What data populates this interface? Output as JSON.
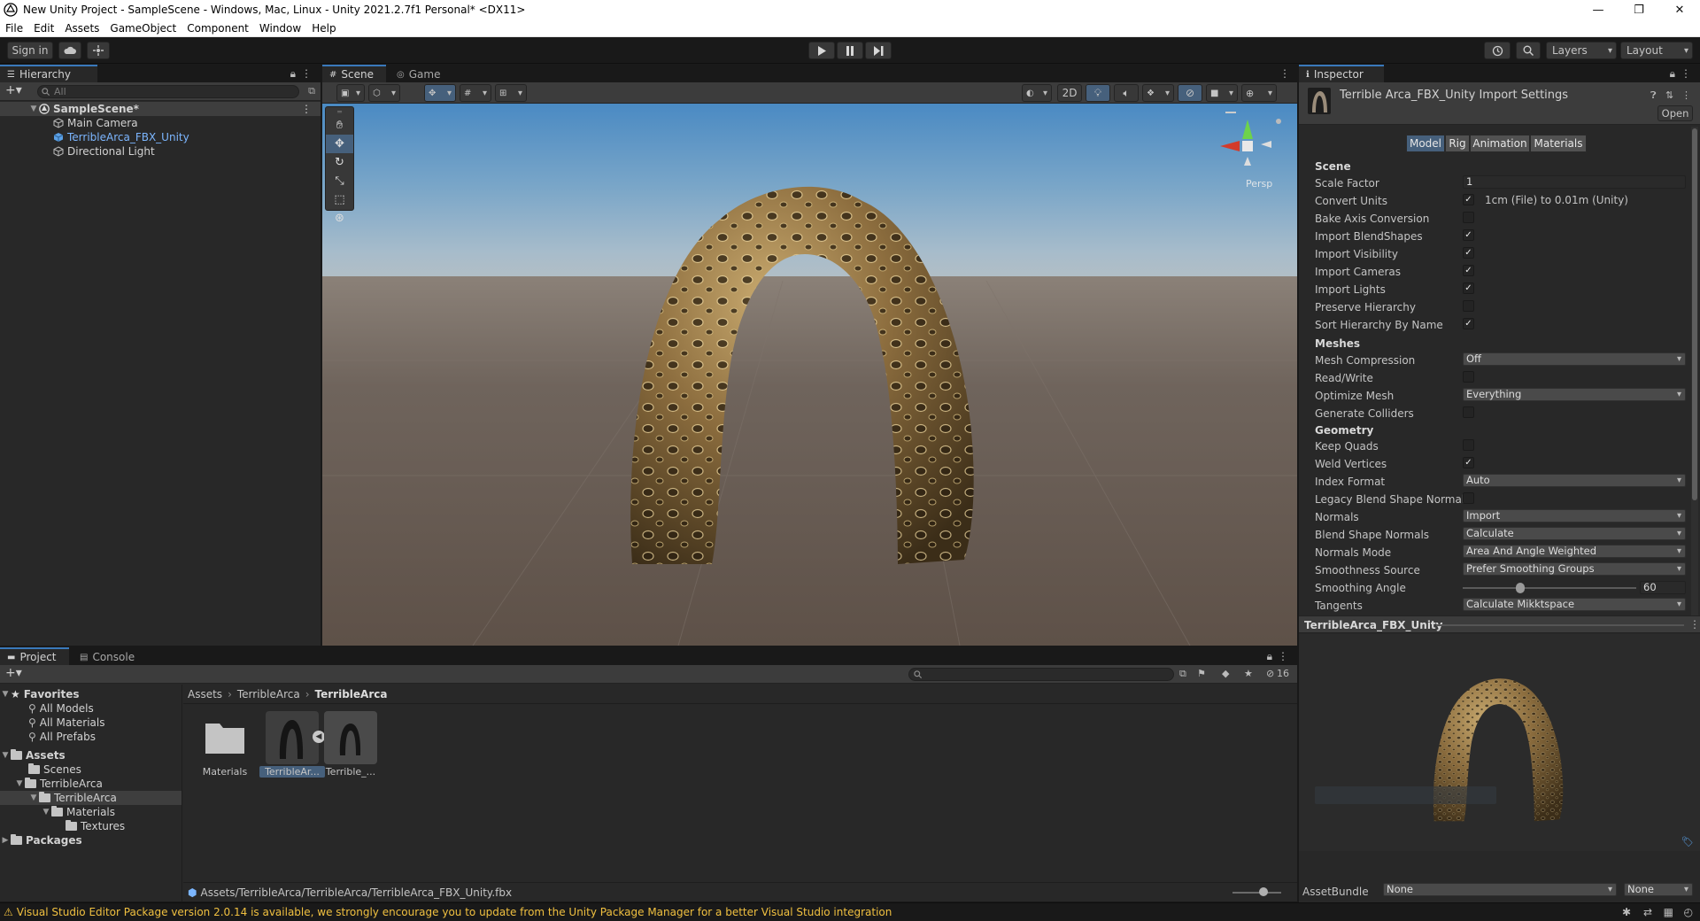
{
  "window": {
    "title": "New Unity Project - SampleScene - Windows, Mac, Linux - Unity 2021.2.7f1 Personal* <DX11>",
    "minimize": "—",
    "restore": "❐",
    "close": "✕"
  },
  "menu": [
    "File",
    "Edit",
    "Assets",
    "GameObject",
    "Component",
    "Window",
    "Help"
  ],
  "toolbar": {
    "sign_in": "Sign in",
    "layers": "Layers",
    "layout": "Layout"
  },
  "hierarchy": {
    "tab": "Hierarchy",
    "search_placeholder": "All",
    "items": [
      {
        "label": "SampleScene*"
      },
      {
        "label": "Main Camera"
      },
      {
        "label": "TerribleArca_FBX_Unity"
      },
      {
        "label": "Directional Light"
      }
    ]
  },
  "scene": {
    "tabs": [
      "Scene",
      "Game"
    ],
    "mode_2d": "2D",
    "persp": "Persp"
  },
  "inspector": {
    "tab": "Inspector",
    "header_title": "Terrible Arca_FBX_Unity Import Settings",
    "open_button": "Open",
    "subtabs": [
      "Model",
      "Rig",
      "Animation",
      "Materials"
    ],
    "section_scene": "Scene",
    "section_meshes": "Meshes",
    "section_geometry": "Geometry",
    "scale_factor_label": "Scale Factor",
    "scale_factor_value": "1",
    "convert_units_label": "Convert Units",
    "convert_units_text": "1cm (File) to 0.01m (Unity)",
    "bake_axis_label": "Bake Axis Conversion",
    "import_blendshapes_label": "Import BlendShapes",
    "import_visibility_label": "Import Visibility",
    "import_cameras_label": "Import Cameras",
    "import_lights_label": "Import Lights",
    "preserve_hierarchy_label": "Preserve Hierarchy",
    "sort_hierarchy_label": "Sort Hierarchy By Name",
    "mesh_compression_label": "Mesh Compression",
    "mesh_compression_value": "Off",
    "read_write_label": "Read/Write",
    "optimize_mesh_label": "Optimize Mesh",
    "optimize_mesh_value": "Everything",
    "generate_colliders_label": "Generate Colliders",
    "keep_quads_label": "Keep Quads",
    "weld_vertices_label": "Weld Vertices",
    "index_format_label": "Index Format",
    "index_format_value": "Auto",
    "legacy_blend_label": "Legacy Blend Shape Normals",
    "normals_label": "Normals",
    "normals_value": "Import",
    "blend_shape_normals_label": "Blend Shape Normals",
    "blend_shape_normals_value": "Calculate",
    "normals_mode_label": "Normals Mode",
    "normals_mode_value": "Area And Angle Weighted",
    "smoothness_source_label": "Smoothness Source",
    "smoothness_source_value": "Prefer Smoothing Groups",
    "smoothing_angle_label": "Smoothing Angle",
    "smoothing_angle_value": "60",
    "smoothing_angle_fraction": 0.333,
    "tangents_label": "Tangents",
    "tangents_value": "Calculate Mikktspace",
    "preview_title": "TerribleArca_FBX_Unity",
    "assetbundle_label": "AssetBundle",
    "assetbundle_value": "None",
    "assetbundle_variant": "None"
  },
  "project": {
    "tabs": [
      "Project",
      "Console"
    ],
    "favorites": "Favorites",
    "fav_items": [
      "All Models",
      "All Materials",
      "All Prefabs"
    ],
    "assets": "Assets",
    "tree": [
      "Scenes",
      "TerribleArca",
      "TerribleArca",
      "Materials",
      "Textures"
    ],
    "packages": "Packages",
    "breadcrumb": [
      "Assets",
      "TerribleArca",
      "TerribleArca"
    ],
    "badge_count": "16",
    "files": [
      "Materials",
      "TerribleAr...",
      "Terrible_..."
    ],
    "path": "Assets/TerribleArca/TerribleArca/TerribleArca_FBX_Unity.fbx"
  },
  "status": {
    "message": "Visual Studio Editor Package version 2.0.14 is available, we strongly encourage you to update from the Unity Package Manager for a better Visual Studio integration"
  },
  "colors": {
    "accent": "#3a79bb",
    "selection": "#46607c",
    "link_blue": "#7cb6ff",
    "warning": "#f0c040"
  }
}
